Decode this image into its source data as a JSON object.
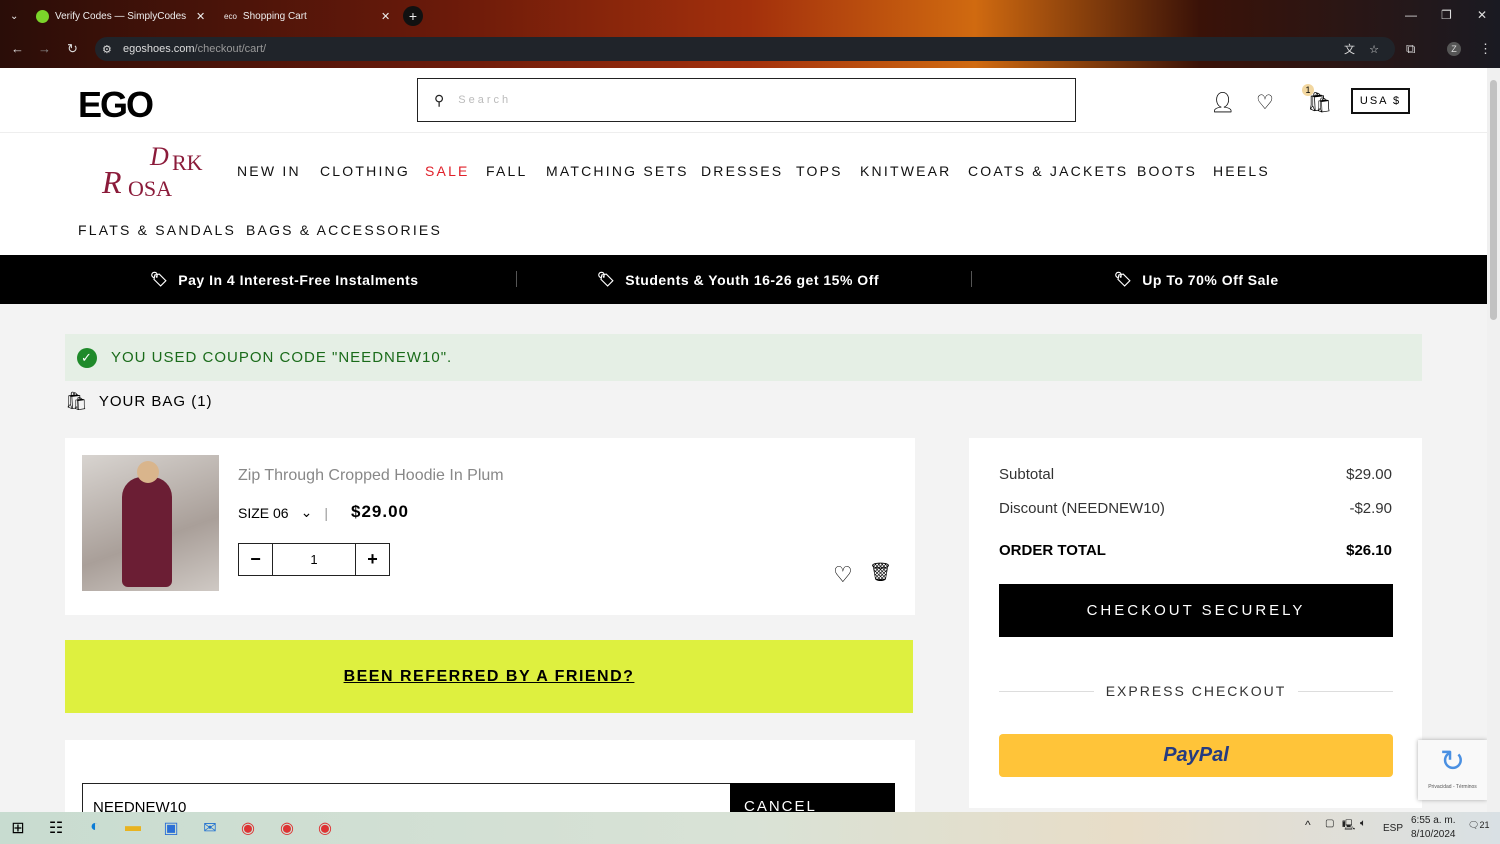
{
  "browser": {
    "tabs": [
      {
        "title": "Verify Codes — SimplyCodes"
      },
      {
        "title": "Shopping Cart"
      }
    ],
    "url_domain": "egoshoes.com",
    "url_path": "/checkout/cart/",
    "profile": "Z"
  },
  "header": {
    "logo": "EGO",
    "search_placeholder": "Search",
    "cart_count": "1",
    "currency": "USA $",
    "brand_logo": "Dark Rosa"
  },
  "nav": [
    "NEW IN",
    "CLOTHING",
    "SALE",
    "FALL",
    "MATCHING SETS",
    "DRESSES",
    "TOPS",
    "KNITWEAR",
    "COATS & JACKETS",
    "BOOTS",
    "HEELS",
    "FLATS & SANDALS",
    "BAGS & ACCESSORIES"
  ],
  "promo": [
    "Pay In 4 Interest-Free Instalments",
    "Students & Youth 16-26 get 15% Off",
    "Up To 70% Off Sale"
  ],
  "coupon_message": "YOU USED COUPON CODE \"NEEDNEW10\".",
  "bag_title": "YOUR BAG (1)",
  "item": {
    "name": "Zip Through Cropped Hoodie In Plum",
    "size": "SIZE 06",
    "price": "$29.00",
    "qty": "1"
  },
  "referral": "BEEN REFERRED BY A FRIEND?",
  "coupon": {
    "value": "NEEDNEW10",
    "button": "CANCEL COUPON"
  },
  "summary": {
    "subtotal_label": "Subtotal",
    "subtotal": "$29.00",
    "discount_label": "Discount (NEEDNEW10)",
    "discount": "-$2.90",
    "total_label": "ORDER TOTAL",
    "total": "$26.10",
    "checkout": "CHECKOUT SECURELY",
    "express": "EXPRESS CHECKOUT",
    "paypal": "PayPal"
  },
  "recaptcha": "Privacidad - Términos",
  "taskbar": {
    "lang": "ESP",
    "time": "6:55 a. m.",
    "date": "8/10/2024",
    "notifications": "21"
  },
  "colors": {
    "sale": "#e0202a",
    "referral": "#def03f",
    "paypal": "#ffc439",
    "success": "#1f8a2a"
  }
}
